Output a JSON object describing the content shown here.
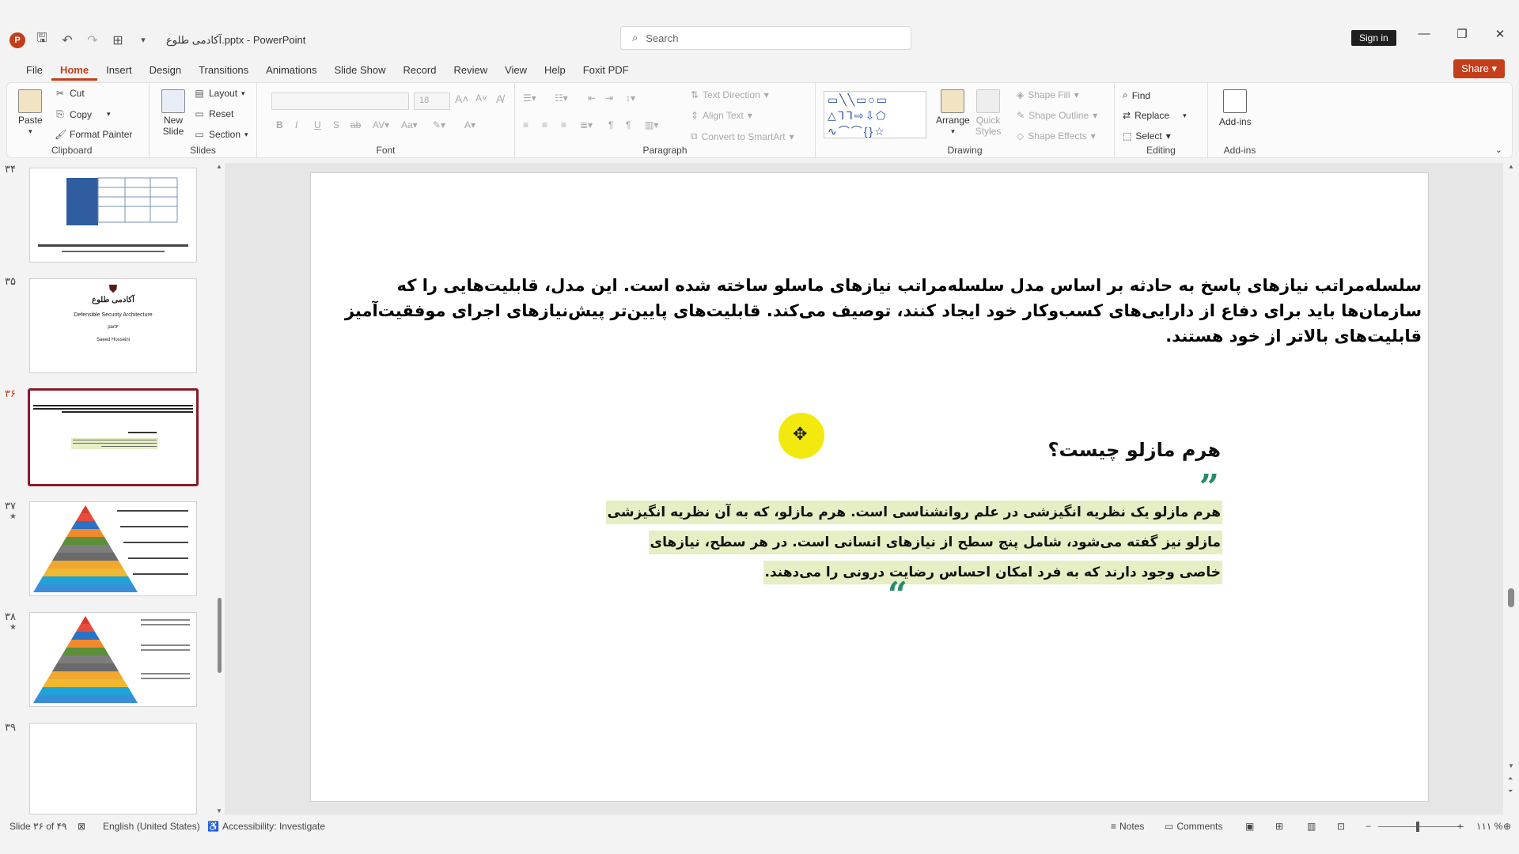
{
  "app": {
    "doc_title": "آکادمی طلوع.pptx",
    "app_name": "PowerPoint",
    "title_sep": " - ",
    "search_placeholder": "Search",
    "signin": "Sign in",
    "share": "Share"
  },
  "menu_tabs": [
    "File",
    "Home",
    "Insert",
    "Design",
    "Transitions",
    "Animations",
    "Slide Show",
    "Record",
    "Review",
    "View",
    "Help",
    "Foxit PDF"
  ],
  "ribbon": {
    "clipboard": {
      "label": "Clipboard",
      "paste": "Paste",
      "cut": "Cut",
      "copy": "Copy",
      "format_painter": "Format Painter"
    },
    "slides": {
      "label": "Slides",
      "new_slide": "New Slide",
      "layout": "Layout",
      "reset": "Reset",
      "section": "Section"
    },
    "font": {
      "label": "Font",
      "size": "18"
    },
    "paragraph": {
      "label": "Paragraph",
      "text_direction": "Text Direction",
      "align_text": "Align Text",
      "convert_smartart": "Convert to SmartArt"
    },
    "drawing": {
      "label": "Drawing",
      "arrange": "Arrange",
      "quick_styles": "Quick Styles",
      "shape_fill": "Shape Fill",
      "shape_outline": "Shape Outline",
      "shape_effects": "Shape Effects"
    },
    "editing": {
      "label": "Editing",
      "find": "Find",
      "replace": "Replace",
      "select": "Select"
    },
    "addins": {
      "label": "Add-ins",
      "addins_btn": "Add-ins"
    }
  },
  "thumbnails": [
    {
      "num": "۳۴",
      "star": ""
    },
    {
      "num": "۳۵",
      "star": "",
      "title": "آکادمی طلوع",
      "line1": "Defensible Security Architecture",
      "line2": "part۳",
      "author": "Saeed Hosseini"
    },
    {
      "num": "۳۶",
      "star": ""
    },
    {
      "num": "۳۷",
      "star": "★"
    },
    {
      "num": "۳۸",
      "star": "★"
    },
    {
      "num": "۳۹",
      "star": ""
    }
  ],
  "slide": {
    "top_text": "سلسله‌مراتب نیازهای پاسخ به حادثه بر اساس مدل سلسله‌مراتب نیازهای ماسلو ساخته شده است. این مدل، قابلیت‌هایی را که سازمان‌ها باید برای دفاع از دارایی‌های کسب‌وکار خود ایجاد کنند، توصیف می‌کند. قابلیت‌های پایین‌تر پیش‌نیازهای اجرای موفقیت‌آمیز قابلیت‌های بالاتر از خود هستند.",
    "heading": "هرم مازلو چیست؟",
    "quote": "هرم مازلو یک نظریه انگیزشی در علم روانشناسی است. هرم مازلو، که به آن نظریه انگیزشی مازلو نیز گفته می‌شود، شامل پنج سطح از نیازهای انسانی است. در هر سطح، نیازهای خاصی وجود دارند که به فرد امکان احساس رضایت درونی را می‌دهند."
  },
  "statusbar": {
    "slide_info": "Slide ۳۶ of ۴۹",
    "language": "English (United States)",
    "accessibility": "Accessibility: Investigate",
    "notes": "Notes",
    "comments": "Comments",
    "zoom": "۱۱۱ %"
  },
  "colors": {
    "accent": "#c43e1c",
    "quote_mark": "#2c8a6a",
    "highlight": "#e6efc4",
    "cursor_highlight": "#f2e90f"
  }
}
